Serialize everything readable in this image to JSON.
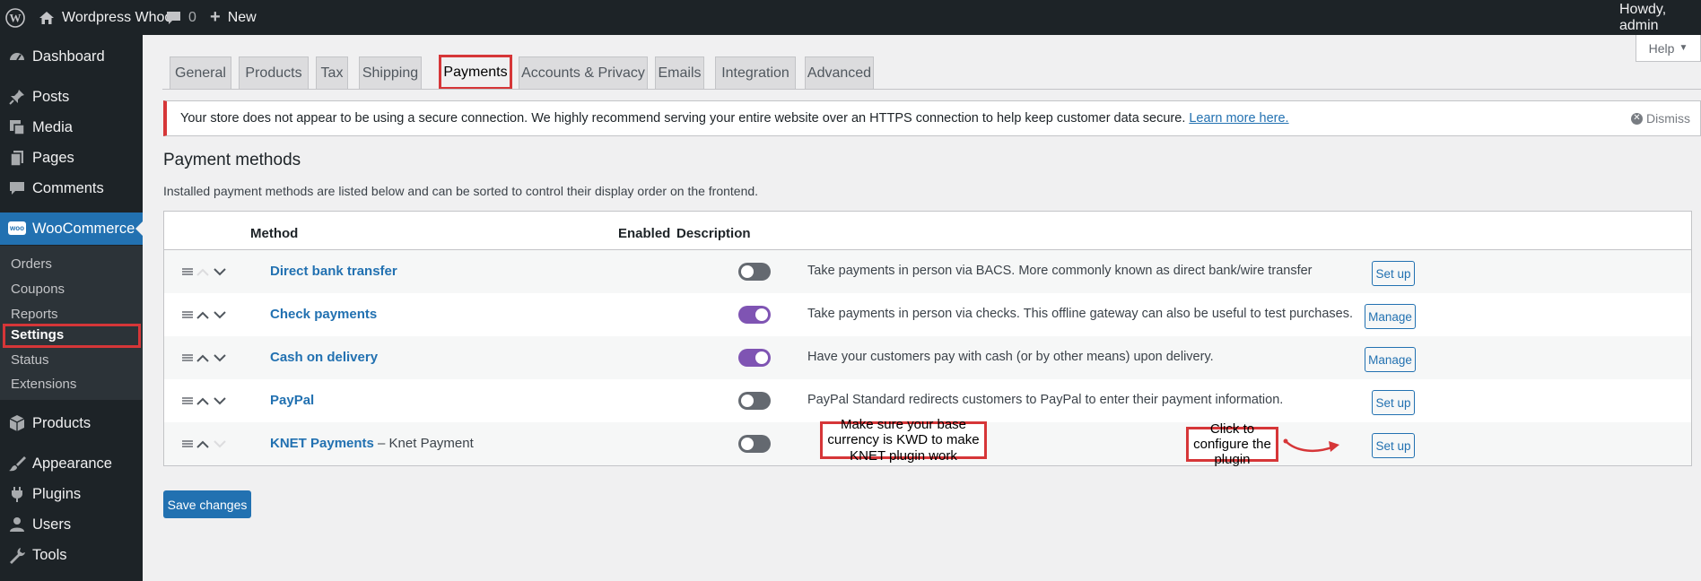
{
  "admin_bar": {
    "site_name": "Wordpress Whoo",
    "comments_count": "0",
    "new_label": "New",
    "howdy": "Howdy, admin"
  },
  "sidebar": {
    "items": [
      {
        "label": "Dashboard",
        "icon": "dashboard-icon"
      },
      {
        "label": "Posts",
        "icon": "pin-icon"
      },
      {
        "label": "Media",
        "icon": "media-icon"
      },
      {
        "label": "Pages",
        "icon": "pages-icon"
      },
      {
        "label": "Comments",
        "icon": "comment-icon"
      },
      {
        "label": "WooCommerce",
        "icon": "woo-icon"
      },
      {
        "label": "Products",
        "icon": "box-icon"
      },
      {
        "label": "Appearance",
        "icon": "brush-icon"
      },
      {
        "label": "Plugins",
        "icon": "plug-icon"
      },
      {
        "label": "Users",
        "icon": "user-icon"
      },
      {
        "label": "Tools",
        "icon": "wrench-icon"
      }
    ],
    "woo_sub": [
      "Orders",
      "Coupons",
      "Reports",
      "Settings",
      "Status",
      "Extensions"
    ],
    "woo_icon_text": "woo"
  },
  "help_label": "Help",
  "tabs": [
    "General",
    "Products",
    "Tax",
    "Shipping",
    "Payments",
    "Accounts & Privacy",
    "Emails",
    "Integration",
    "Advanced"
  ],
  "notice": {
    "text": "Your store does not appear to be using a secure connection. We highly recommend serving your entire website over an HTTPS connection to help keep customer data secure.",
    "link": "Learn more here.",
    "dismiss": "Dismiss"
  },
  "payments": {
    "title": "Payment methods",
    "description": "Installed payment methods are listed below and can be sorted to control their display order on the frontend.",
    "columns": {
      "method": "Method",
      "enabled": "Enabled",
      "description": "Description"
    },
    "rows": [
      {
        "name": "Direct bank transfer",
        "subtitle": "",
        "enabled": false,
        "description": "Take payments in person via BACS. More commonly known as direct bank/wire transfer",
        "action": "Set up"
      },
      {
        "name": "Check payments",
        "subtitle": "",
        "enabled": true,
        "description": "Take payments in person via checks. This offline gateway can also be useful to test purchases.",
        "action": "Manage"
      },
      {
        "name": "Cash on delivery",
        "subtitle": "",
        "enabled": true,
        "description": "Have your customers pay with cash (or by other means) upon delivery.",
        "action": "Manage"
      },
      {
        "name": "PayPal",
        "subtitle": "",
        "enabled": false,
        "description": "PayPal Standard redirects customers to PayPal to enter their payment information.",
        "action": "Set up"
      },
      {
        "name": "KNET Payments",
        "subtitle": " – Knet Payment",
        "enabled": false,
        "description": "",
        "action": "Set up"
      }
    ]
  },
  "save_label": "Save changes",
  "annotations": {
    "currency_note": "Make sure your base currency is KWD to make KNET plugin work",
    "configure_note": "Click to configure the plugin"
  },
  "colors": {
    "accent": "#2271b1",
    "highlight": "#d63638",
    "toggle_on": "#7f54b3",
    "admin_dark": "#1d2327"
  }
}
